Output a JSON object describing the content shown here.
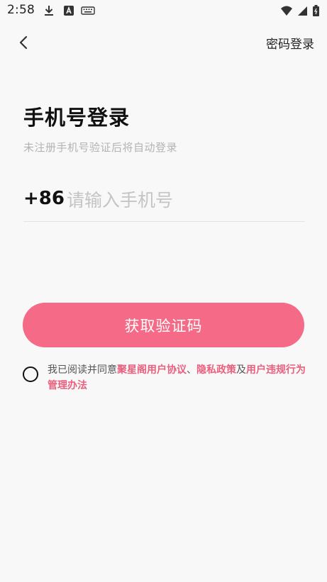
{
  "status_bar": {
    "time": "2:58",
    "icons": [
      "download-icon",
      "a-badge-icon",
      "keyboard-icon",
      "wifi-icon",
      "signal-icon",
      "battery-icon"
    ]
  },
  "nav": {
    "back_icon": "chevron-left-icon",
    "password_login": "密码登录"
  },
  "login": {
    "title": "手机号登录",
    "subtitle": "未注册手机号验证后将自动登录",
    "country_code": "+86",
    "phone_placeholder": "请输入手机号",
    "phone_value": "",
    "get_code_button": "获取验证码"
  },
  "agreement": {
    "checked": false,
    "prefix": "我已阅读并同意",
    "user_agreement": "聚星阁用户协议",
    "separator": "、",
    "privacy_policy": "隐私政策",
    "conjunction": "及",
    "violation_rules": "用户违规行为管理办法"
  },
  "colors": {
    "background": "#f8f8f8",
    "accent": "#f56a86",
    "link": "#e9607f",
    "placeholder": "#c4c4c4",
    "subtitle": "#b3b3b3"
  }
}
